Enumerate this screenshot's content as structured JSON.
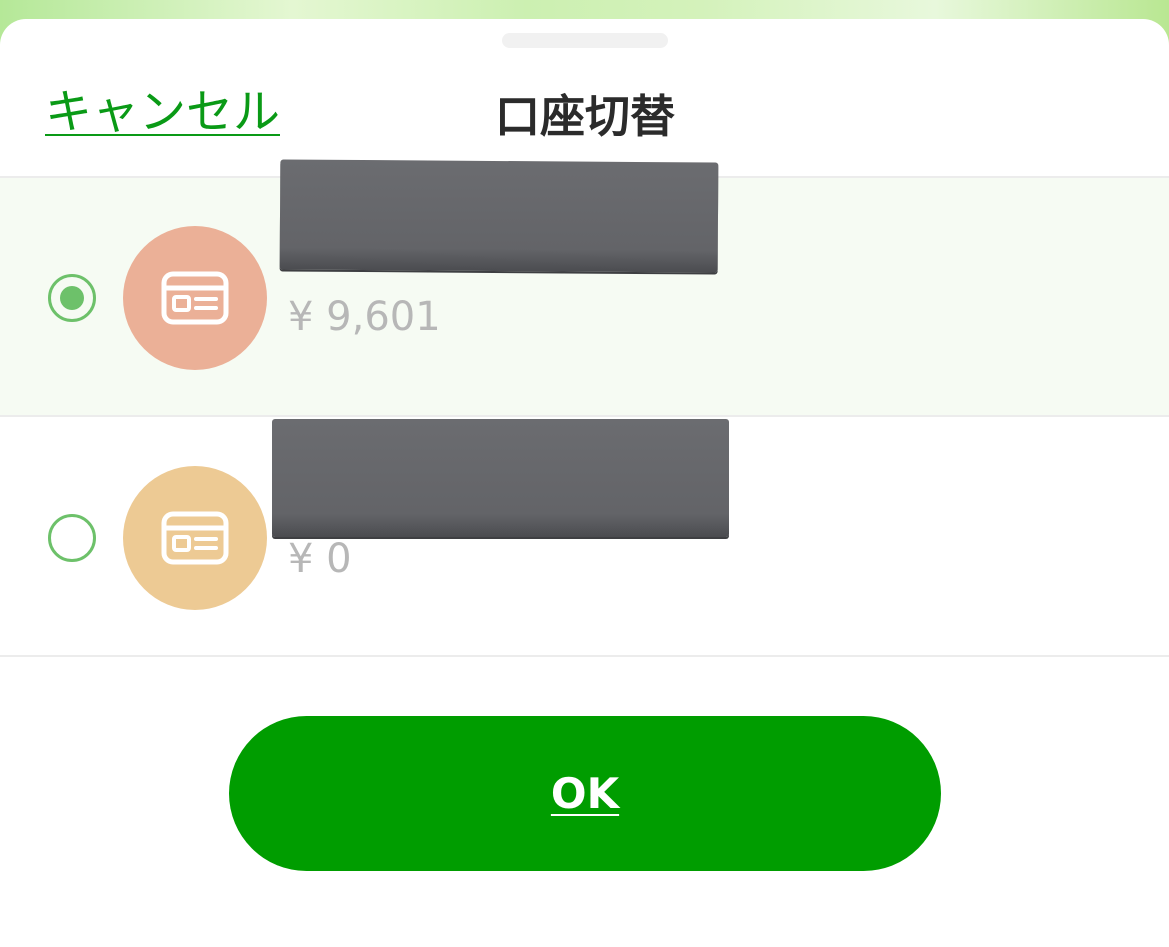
{
  "header": {
    "cancel_label": "キャンセル",
    "title": "口座切替"
  },
  "accounts": [
    {
      "name_redacted": true,
      "balance": "¥ 9,601",
      "selected": true,
      "icon": "card-icon",
      "icon_color": "#ebb097"
    },
    {
      "name_redacted": true,
      "balance": "¥ 0",
      "selected": false,
      "icon": "card-icon",
      "icon_color": "#edca94"
    }
  ],
  "ok_label": "OK",
  "colors": {
    "accent": "#009d00",
    "link": "#0a9a16",
    "radio": "#6dc16a",
    "selected_row_bg": "#f6fbf3"
  }
}
